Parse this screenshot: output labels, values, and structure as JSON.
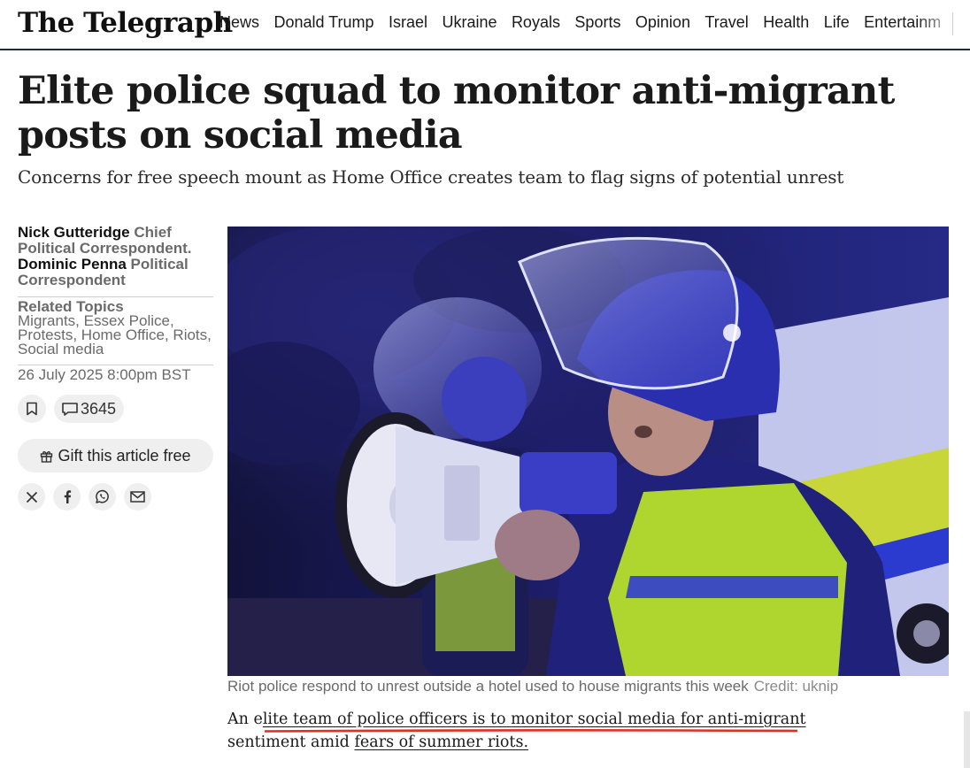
{
  "header": {
    "logo": "The Telegraph",
    "nav": [
      "News",
      "Donald Trump",
      "Israel",
      "Ukraine",
      "Royals",
      "Sports",
      "Opinion",
      "Travel",
      "Health",
      "Life",
      "Entertainm"
    ]
  },
  "article": {
    "headline": "Elite police squad to monitor anti-migrant posts on social media",
    "standfirst": "Concerns for free speech mount as Home Office creates team to flag signs of potential unrest",
    "authors": [
      {
        "name": "Nick Gutteridge",
        "role": "Chief Political Correspondent."
      },
      {
        "name": "Dominic Penna",
        "role": "Political Correspondent"
      }
    ],
    "related_topics_title": "Related Topics",
    "related_topics": "Migrants, Essex Police, Protests, Home Office, Riots, Social media",
    "date": "26 July 2025 8:00pm BST",
    "comment_count": "3645",
    "gift_label": "Gift this article free",
    "caption": "Riot police respond to unrest outside a hotel used to house migrants this week",
    "credit": "Credit: uknip",
    "body": {
      "lead": "An e",
      "link1": "lite team of police officers is to monitor social media for anti-migrant",
      "middle": " sentiment amid ",
      "link2": "fears of summer riots."
    }
  },
  "icons": [
    "bookmark-icon",
    "comment-icon",
    "gift-icon",
    "x-icon",
    "facebook-icon",
    "whatsapp-icon",
    "email-icon"
  ],
  "colors": {
    "annotation_underline": "#e0301e",
    "header_rule": "#1f2d3a",
    "muted_text": "#6a6a6a"
  }
}
